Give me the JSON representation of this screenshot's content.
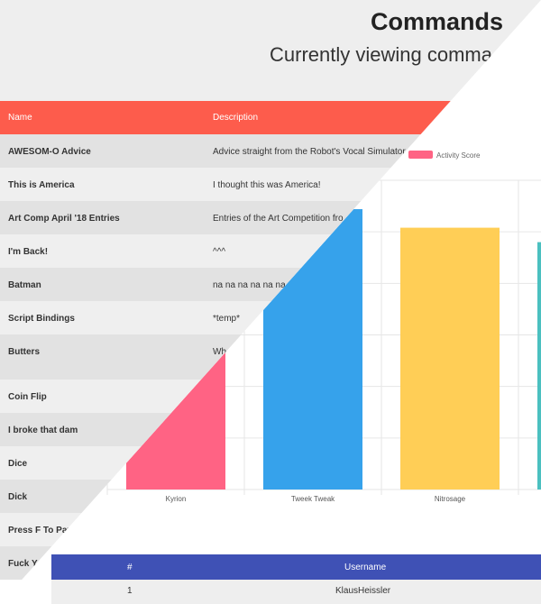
{
  "header": {
    "title": "Commands",
    "subtitle": "Currently viewing comma"
  },
  "commands_table": {
    "columns": [
      "Name",
      "Description"
    ],
    "rows": [
      {
        "name": "AWESOM-O Advice",
        "description": "Advice straight from the Robot's Vocal Simulator"
      },
      {
        "name": "This is America",
        "description": "I thought this was America!"
      },
      {
        "name": "Art Comp April '18 Entries",
        "description": "Entries of the Art Competition fro"
      },
      {
        "name": "I'm Back!",
        "description": "^^^"
      },
      {
        "name": "Batman",
        "description": "na na na na na na"
      },
      {
        "name": "Script Bindings",
        "description": "*temp*"
      },
      {
        "name": "Butters",
        "description": "Wh"
      },
      {
        "name": "Coin Flip",
        "description": ""
      },
      {
        "name": "I broke that dam",
        "description": ""
      },
      {
        "name": "Dice",
        "description": ""
      },
      {
        "name": "Dick",
        "description": ""
      },
      {
        "name": "Press F To Pay",
        "description": ""
      },
      {
        "name": "Fuck Y",
        "description": ""
      }
    ]
  },
  "chart_data": {
    "type": "bar",
    "categories": [
      "Kyrion",
      "Tweek Tweak",
      "Nitrosage",
      ""
    ],
    "series": [
      {
        "name": "Activity Score",
        "values": [
          155,
          272,
          254,
          240
        ],
        "colors": [
          "#ff6384",
          "#36a2eb",
          "#ffce56",
          "#4bc0c0"
        ]
      }
    ],
    "legend_color": "#ff6384",
    "grid": true,
    "ylim": [
      0,
      300
    ]
  },
  "users_table": {
    "columns": [
      "#",
      "Username"
    ],
    "rows": [
      {
        "rank": "1",
        "username": "KlausHeissler"
      }
    ]
  }
}
